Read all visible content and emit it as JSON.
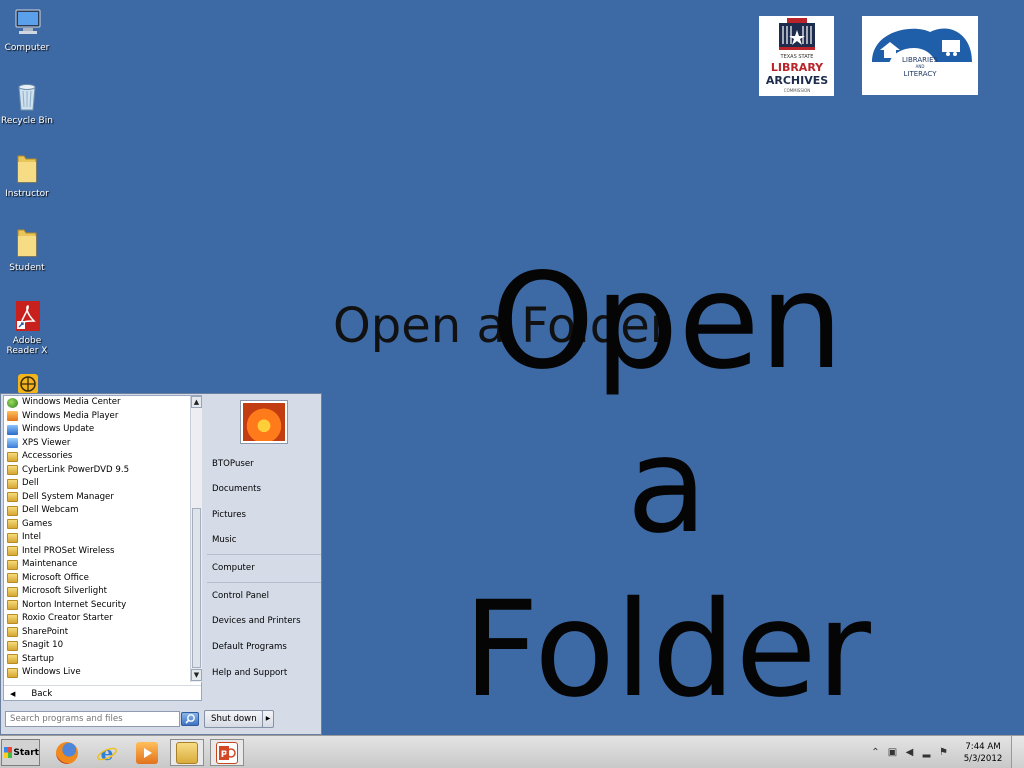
{
  "desktop": {
    "background": "#3d6aa5",
    "icons": [
      {
        "label": "Computer",
        "icon": "computer-icon"
      },
      {
        "label": "Recycle Bin",
        "icon": "recycle-bin-icon"
      },
      {
        "label": "Instructor",
        "icon": "folder-icon"
      },
      {
        "label": "Student",
        "icon": "folder-icon"
      },
      {
        "label": "Adobe Reader X",
        "icon": "adobe-reader-icon"
      }
    ]
  },
  "logos": {
    "tsl": {
      "line1": "TEXAS STATE",
      "line2": "LIBRARY",
      "line3": "ARCHIVES",
      "line4": "COMMISSION"
    },
    "literacy": {
      "line1": "LIBRARIES",
      "line2": "AND",
      "line3": "LITERACY"
    }
  },
  "overlay": {
    "small_title": "Open a Folder",
    "big_line1": "Open a",
    "big_line2": "Folder"
  },
  "start_menu": {
    "programs": [
      {
        "label": "Windows Media Center",
        "icon": "media-center-icon"
      },
      {
        "label": "Windows Media Player",
        "icon": "media-player-icon"
      },
      {
        "label": "Windows Update",
        "icon": "windows-update-icon"
      },
      {
        "label": "XPS Viewer",
        "icon": "xps-viewer-icon"
      },
      {
        "label": "Accessories",
        "icon": "folder-icon"
      },
      {
        "label": "CyberLink PowerDVD 9.5",
        "icon": "folder-icon"
      },
      {
        "label": "Dell",
        "icon": "folder-icon"
      },
      {
        "label": "Dell System Manager",
        "icon": "folder-icon"
      },
      {
        "label": "Dell Webcam",
        "icon": "folder-icon"
      },
      {
        "label": "Games",
        "icon": "folder-icon"
      },
      {
        "label": "Intel",
        "icon": "folder-icon"
      },
      {
        "label": "Intel PROSet Wireless",
        "icon": "folder-icon"
      },
      {
        "label": "Maintenance",
        "icon": "folder-icon"
      },
      {
        "label": "Microsoft Office",
        "icon": "folder-icon"
      },
      {
        "label": "Microsoft Silverlight",
        "icon": "folder-icon"
      },
      {
        "label": "Norton Internet Security",
        "icon": "folder-icon"
      },
      {
        "label": "Roxio Creator Starter",
        "icon": "folder-icon"
      },
      {
        "label": "SharePoint",
        "icon": "folder-icon"
      },
      {
        "label": "Snagit 10",
        "icon": "folder-icon"
      },
      {
        "label": "Startup",
        "icon": "folder-icon"
      },
      {
        "label": "Windows Live",
        "icon": "folder-icon"
      }
    ],
    "back_label": "Back",
    "search_placeholder": "Search programs and files",
    "right_items": [
      "BTOPuser",
      "Documents",
      "Pictures",
      "Music",
      "Computer",
      "Control Panel",
      "Devices and Printers",
      "Default Programs",
      "Help and Support"
    ],
    "shutdown_label": "Shut down"
  },
  "taskbar": {
    "start_label": "Start",
    "apps": [
      "firefox-icon",
      "internet-explorer-icon",
      "media-player-icon",
      "windows-explorer-icon",
      "powerpoint-icon"
    ],
    "clock_time": "7:44 AM",
    "clock_date": "5/3/2012"
  }
}
